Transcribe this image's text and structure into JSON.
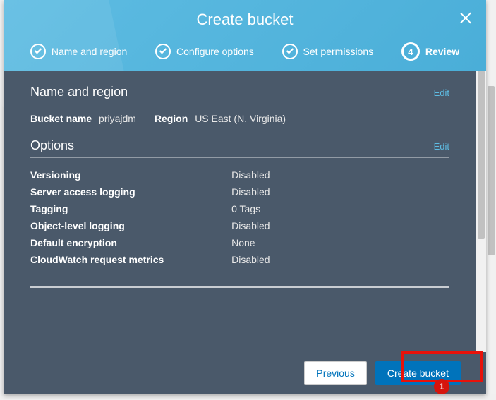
{
  "dialog": {
    "title": "Create bucket"
  },
  "steps": [
    {
      "label": "Name and region",
      "done": true
    },
    {
      "label": "Configure options",
      "done": true
    },
    {
      "label": "Set permissions",
      "done": true
    },
    {
      "label": "Review",
      "num": "4",
      "active": true
    }
  ],
  "sections": {
    "nameRegion": {
      "title": "Name and region",
      "edit": "Edit",
      "bucketNameLabel": "Bucket name",
      "bucketNameValue": "priyajdm",
      "regionLabel": "Region",
      "regionValue": "US East (N. Virginia)"
    },
    "options": {
      "title": "Options",
      "edit": "Edit",
      "rows": [
        {
          "k": "Versioning",
          "v": "Disabled"
        },
        {
          "k": "Server access logging",
          "v": "Disabled"
        },
        {
          "k": "Tagging",
          "v": "0 Tags"
        },
        {
          "k": "Object-level logging",
          "v": "Disabled"
        },
        {
          "k": "Default encryption",
          "v": "None"
        },
        {
          "k": "CloudWatch request metrics",
          "v": "Disabled"
        }
      ]
    }
  },
  "footer": {
    "previous": "Previous",
    "create": "Create bucket"
  },
  "annotation": {
    "badge1": "1"
  }
}
